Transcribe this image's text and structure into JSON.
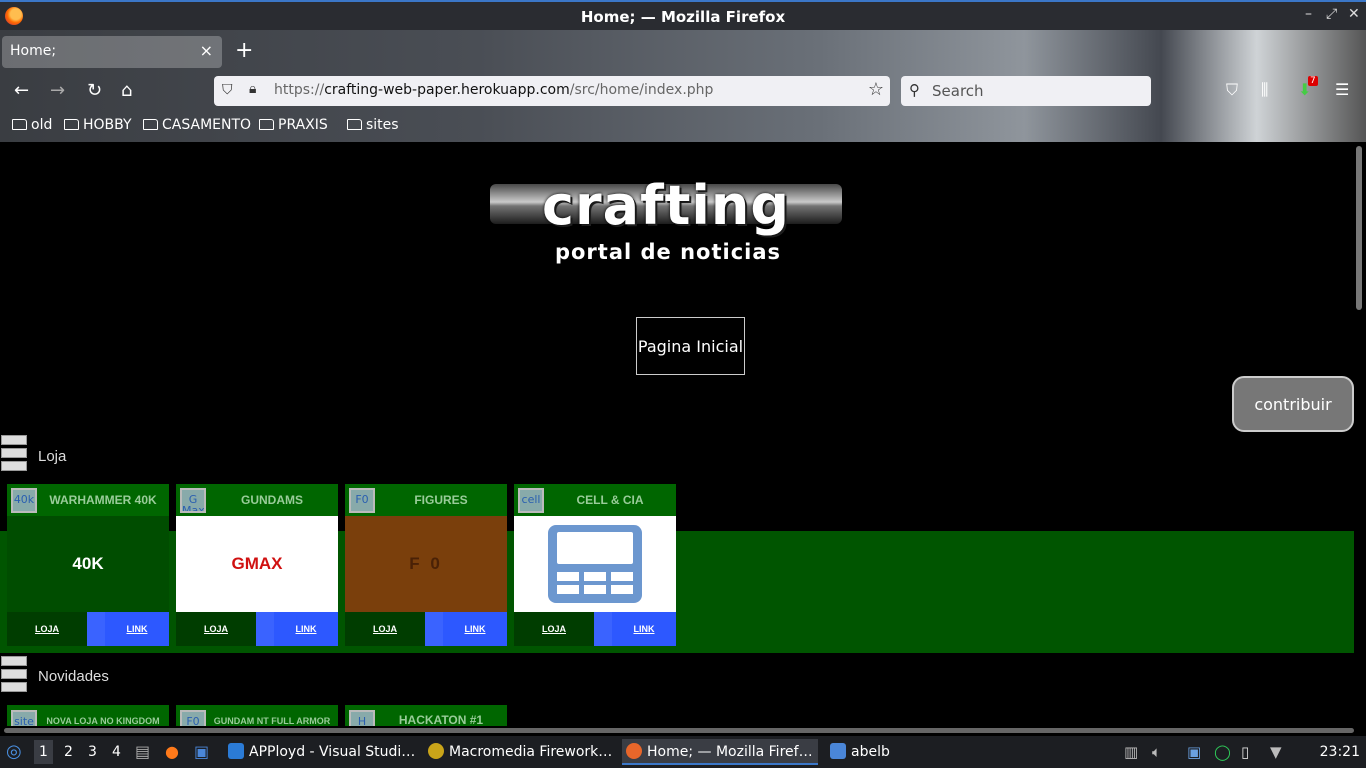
{
  "window": {
    "title": "Home; — Mozilla Firefox"
  },
  "tab": {
    "title": "Home;",
    "close_glyph": "×",
    "new_glyph": "+"
  },
  "nav": {
    "back_glyph": "←",
    "forward_glyph": "→",
    "reload_glyph": "↻",
    "home_glyph": "⌂",
    "url_prefix": "https://",
    "url_domain": "crafting-web-paper.herokuapp.com",
    "url_path": "/src/home/index.php",
    "star_glyph": "☆",
    "search_placeholder": "Search",
    "notification_count": "7"
  },
  "bookmarks": [
    "old",
    "HOBBY",
    "CASAMENTO",
    "PRAXIS",
    "sites"
  ],
  "page": {
    "logo_word": "crafting",
    "logo_subtitle": "portal de noticias",
    "home_button": "Pagina Inicial",
    "contribute_button": "contribuir",
    "sections": {
      "loja": {
        "label": "Loja",
        "cards": [
          {
            "abbr": "40k",
            "name": "WARHAMMER 40K",
            "image_text": "40K",
            "image_bg": "#004d00",
            "image_color": "#ffffff",
            "loja": "LOJA",
            "link": "LINK"
          },
          {
            "abbr": "G Max",
            "name": "GUNDAMS",
            "image_text": "GMAX",
            "image_bg": "#ffffff",
            "image_color": "#d01010",
            "loja": "LOJA",
            "link": "LINK"
          },
          {
            "abbr": "F0",
            "name": "FIGURES",
            "image_text": "F 0",
            "image_bg": "#7a3f0c",
            "image_color": "#4a2106",
            "loja": "LOJA",
            "link": "LINK"
          },
          {
            "abbr": "cell",
            "name": "CELL & CIA",
            "image_text": "",
            "image_bg": "#ffffff",
            "image_color": "#6c97cf",
            "loja": "LOJA",
            "link": "LINK"
          }
        ]
      },
      "novidades": {
        "label": "Novidades",
        "cards": [
          {
            "abbr": "site",
            "name": "NOVA LOJA NO KINGDOM"
          },
          {
            "abbr": "F0",
            "name": "GUNDAM NT FULL ARMOR"
          },
          {
            "abbr": "H",
            "name": "HACKATON #1"
          }
        ]
      }
    }
  },
  "taskbar": {
    "workspaces": [
      "1",
      "2",
      "3",
      "4"
    ],
    "apps": [
      {
        "label": "APPloyd - Visual Studi…",
        "icon": "vscode-icon",
        "color": "#2b7bd6"
      },
      {
        "label": "Macromedia Firework…",
        "icon": "fireworks-icon",
        "color": "#c9a419"
      },
      {
        "label": "Home; — Mozilla Firef…",
        "icon": "firefox-icon",
        "color": "#e8662a"
      },
      {
        "label": "abelb",
        "icon": "folder-icon",
        "color": "#4a86d8"
      }
    ],
    "clock": "23:21"
  }
}
